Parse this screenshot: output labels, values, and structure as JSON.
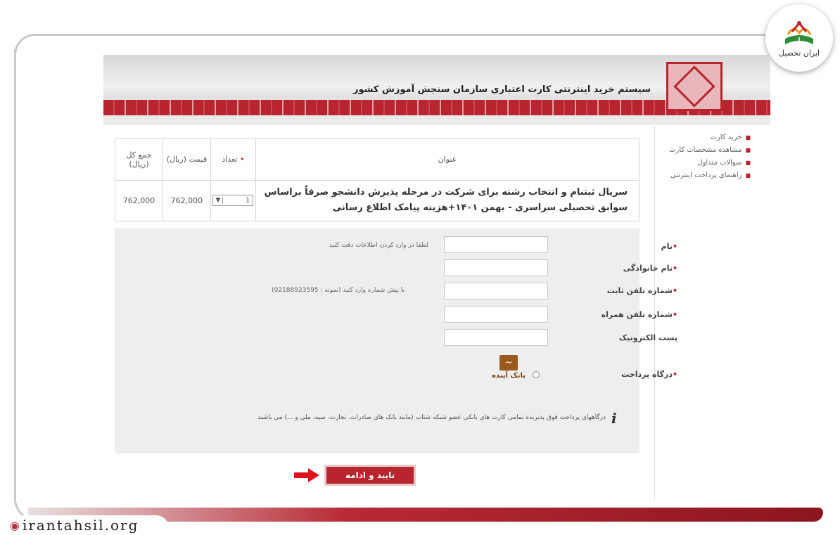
{
  "watermark": {
    "site_url": "irantahsil.org",
    "logo_text": "ایران تحصیل"
  },
  "banner": {
    "title": "سیستم خرید اینترنتی کارت اعتباری سازمان سنجش آموزش کشور"
  },
  "side_nav": {
    "items": [
      {
        "label": "خرید کارت"
      },
      {
        "label": "مشاهده مشخصات کارت"
      },
      {
        "label": "سوالات متداول"
      },
      {
        "label": "راهنمای پرداخت اینترنتی"
      }
    ]
  },
  "cart": {
    "headers": {
      "title": "عنوان",
      "qty": "تعداد",
      "price": "قیمت (ریال)",
      "total": "جمع کل (ریال)"
    },
    "row": {
      "title": "سریال ثبتنام و انتخاب رشته برای شرکت در مرحله پذیرش دانشجو صرفاً براساس سوابق تحصیلی سراسری - بهمن ۱۴۰۱+هزینه پیامک اطلاع رسانی",
      "qty": "1",
      "price": "762,000",
      "total": "762,000"
    }
  },
  "form": {
    "name_label": "نام",
    "name_hint": "لطفا در وارد کردن اطلاعات دقت کنید",
    "lastname_label": "نام خانوادگی",
    "phone_label": "شماره تلفن ثابت",
    "phone_hint": "با پیش شماره وارد کنید (نمونه : 02188923595)",
    "mobile_label": "شماره تلفن همراه",
    "email_label": "پست الکترونیک",
    "gateway_label": "درگاه پرداخت",
    "bank_name": "بانک آینده",
    "info_text": "درگاههای پرداخت فوق پذیرنده تمامی کارت های بانکی عضو شبکه شتاب (مانند بانک های صادرات، تجارت، سپه، ملی و ...) می باشند"
  },
  "submit": {
    "label": "تایید و ادامه"
  },
  "colors": {
    "brand_red": "#b8252f",
    "panel_gray": "#eeeeee"
  }
}
